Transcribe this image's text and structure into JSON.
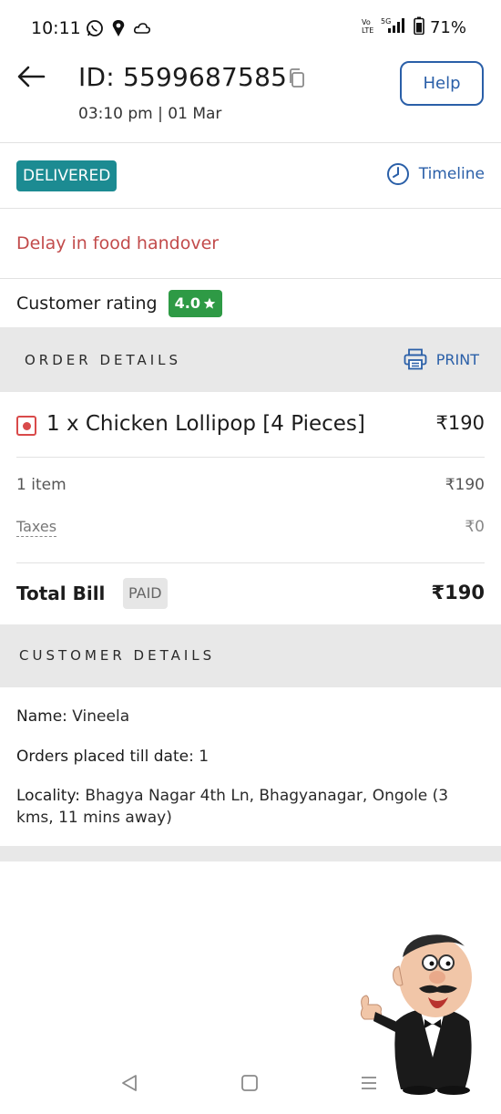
{
  "status_bar": {
    "time": "10:11",
    "battery": "71%",
    "icons": [
      "whatsapp-icon",
      "location-icon",
      "cloud-icon",
      "volte-icon",
      "5g-signal-icon",
      "battery-icon"
    ]
  },
  "header": {
    "order_id": "ID: 5599687585",
    "order_time": "03:10 pm | 01 Mar",
    "help_label": "Help"
  },
  "status": {
    "badge": "DELIVERED",
    "timeline_label": "Timeline",
    "delay_text": "Delay in food handover"
  },
  "rating": {
    "label": "Customer rating",
    "value": "4.0"
  },
  "order_details": {
    "title": "ORDER DETAILS",
    "print_label": "PRINT",
    "items": [
      {
        "name": "1 x Chicken Lollipop [4 Pieces]",
        "price": "₹190"
      }
    ],
    "item_count_label": "1 item",
    "subtotal": "₹190",
    "taxes_label": "Taxes",
    "taxes_value": "₹0",
    "total_label": "Total Bill",
    "paid_badge": "PAID",
    "total_value": "₹190"
  },
  "customer_details": {
    "title": "CUSTOMER DETAILS",
    "name_key": "Name:",
    "name_value": "Vineela",
    "orders_key": "Orders placed till date:",
    "orders_value": "1",
    "locality_key": "Locality:",
    "locality_value": "Bhagya Nagar 4th Ln, Bhagyanagar, Ongole (3 kms, 11 mins away)"
  },
  "colors": {
    "accent_blue": "#2a5fa8",
    "delivered_teal": "#1c8b92",
    "rating_green": "#2e9a45",
    "delay_red": "#c24b4b",
    "section_gray": "#e8e8e8"
  }
}
